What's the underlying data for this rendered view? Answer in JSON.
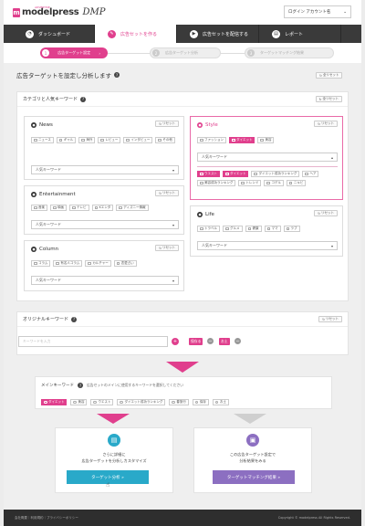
{
  "header": {
    "logo_text": "modelpress",
    "logo_sub": "ADVERTISE",
    "logo_dmp": "DMP",
    "account_label": "ログイン アカウント名",
    "account_caret": "⌄"
  },
  "nav": [
    {
      "label": "ダッシュボード",
      "icon": "speedometer-icon"
    },
    {
      "label": "広告セットを作る",
      "icon": "tag-icon"
    },
    {
      "label": "広告セットを配信する",
      "icon": "send-icon"
    },
    {
      "label": "レポート",
      "icon": "report-icon"
    }
  ],
  "steps": [
    {
      "num": "1",
      "label": "広告ターゲット設定",
      "arrow": "›"
    },
    {
      "num": "2",
      "label": "広告ターゲット分析"
    },
    {
      "num": "3",
      "label": "ターゲットマッチング結果"
    }
  ],
  "title": "広告ターゲットを設定し分析します",
  "title_help": "?",
  "help_label": "?",
  "reset_all_label": "全リセット",
  "reset_label": "リセット",
  "category_panel": {
    "title": "カテゴリと人気キーワード",
    "reset_label": "全リセット"
  },
  "categories": {
    "news": {
      "title": "News",
      "chips": [
        "ニュース",
        "ギャル",
        "海外",
        "レビュー",
        "インタビュー",
        "その他"
      ],
      "select": "人気キーワード"
    },
    "entertainment": {
      "title": "Entertainment",
      "chips": [
        "音楽",
        "映画",
        "テレビ",
        "Kエンタ",
        "ディズニー情報"
      ],
      "select": "人気キーワード"
    },
    "column": {
      "title": "Column",
      "chips": [
        "コラム",
        "有名人コラム",
        "カルチャー",
        "恋愛占い"
      ],
      "select": "人気キーワード"
    },
    "style": {
      "title": "Style",
      "chips": [
        "ファッション",
        "ダイエット",
        "美容"
      ],
      "select": "人気キーワード",
      "keywords": [
        "ウエスト",
        "ダイエット",
        "ダイエット成功ランキング",
        "ヘア",
        "美容成功ランキング",
        "トレンド",
        "コデル",
        "ニキビ"
      ],
      "keywords_on": [
        "ウエスト",
        "ダイエット"
      ]
    },
    "life": {
      "title": "Life",
      "chips": [
        "トラベル",
        "グルメ",
        "健康",
        "ママ",
        "ラブ"
      ],
      "select": "人気キーワード"
    }
  },
  "original": {
    "title": "オリジナルキーワード",
    "reset_label": "リセット",
    "placeholder": "キーワードを入力",
    "add_symbol": "+",
    "tag1": "保存る",
    "tag2": "お土",
    "remove_symbol": "−"
  },
  "main_keyword": {
    "label": "メインキーワード",
    "description": "広告セットのメインに使用するキーワードを選択してください",
    "options": [
      {
        "label": "ダイエット",
        "on": true
      },
      {
        "label": "美容",
        "on": false
      },
      {
        "label": "ウエスト",
        "on": false
      },
      {
        "label": "ダイエット成功ランキング",
        "on": false
      },
      {
        "label": "春旅行",
        "on": false
      },
      {
        "label": "保存",
        "on": false
      },
      {
        "label": "お土",
        "on": false
      }
    ]
  },
  "actions": {
    "analyze": {
      "line1": "さらに詳細に",
      "line2": "広告ターゲットを分析しカスタマイズ",
      "button": "ターゲット分析 »",
      "icon": "document-icon",
      "color": "#29a9c9"
    },
    "matching": {
      "line1": "この広告ターゲット設定で",
      "line2": "分析結果をみる",
      "button": "ターゲットマッチング結果 »",
      "icon": "monitor-icon",
      "color": "#8c6fc1"
    }
  },
  "footer": {
    "links": "会社概要｜利用規約｜プライバシーポリシー",
    "copyright": "Copyright © modelpress All Rights Reserved."
  },
  "colors": {
    "accent": "#e03f8d",
    "nav": "#3a3a3a",
    "analyze": "#29a9c9",
    "matching": "#8c6fc1"
  }
}
